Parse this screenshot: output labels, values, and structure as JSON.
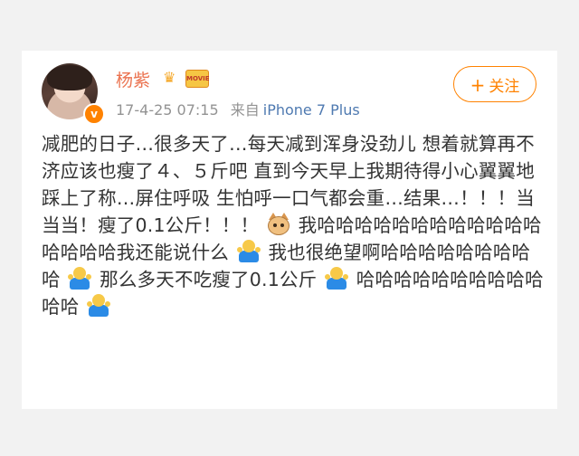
{
  "post": {
    "username": "杨紫",
    "badge_crown_icon": "crown-icon",
    "badge_movie_text": "MOVIE",
    "verified_mark": "v",
    "timestamp": "17-4-25 07:15",
    "source_prefix": "来自",
    "source_device": "iPhone 7 Plus",
    "follow_button": {
      "plus": "+",
      "label": "关注"
    },
    "text_segments": {
      "s1": "减肥的日子…很多天了…每天减到浑身没劲儿 想着就算再不济应该也瘦了４、５斤吧 直到今天早上我期待得小心翼翼地踩上了称…屏住呼吸 生怕呼一口气都会重…结果…！！！当当当！瘦了0.1公斤！！！",
      "s2": "我哈哈哈哈哈哈哈哈哈哈哈哈哈哈哈哈我还能说什么",
      "s3": "我也很绝望啊哈哈哈哈哈哈哈哈哈",
      "s4": "那么多天不吃瘦了0.1公斤",
      "s5": "哈哈哈哈哈哈哈哈哈哈哈哈"
    },
    "emoji_icons": [
      "cat-face-icon",
      "shrug-icon",
      "shrug-icon",
      "shrug-icon",
      "shrug-icon"
    ]
  },
  "colors": {
    "username": "#eb7350",
    "accent": "#ff8200",
    "meta_gray": "#939393",
    "source_blue": "#4f7ab1",
    "text": "#333333"
  }
}
